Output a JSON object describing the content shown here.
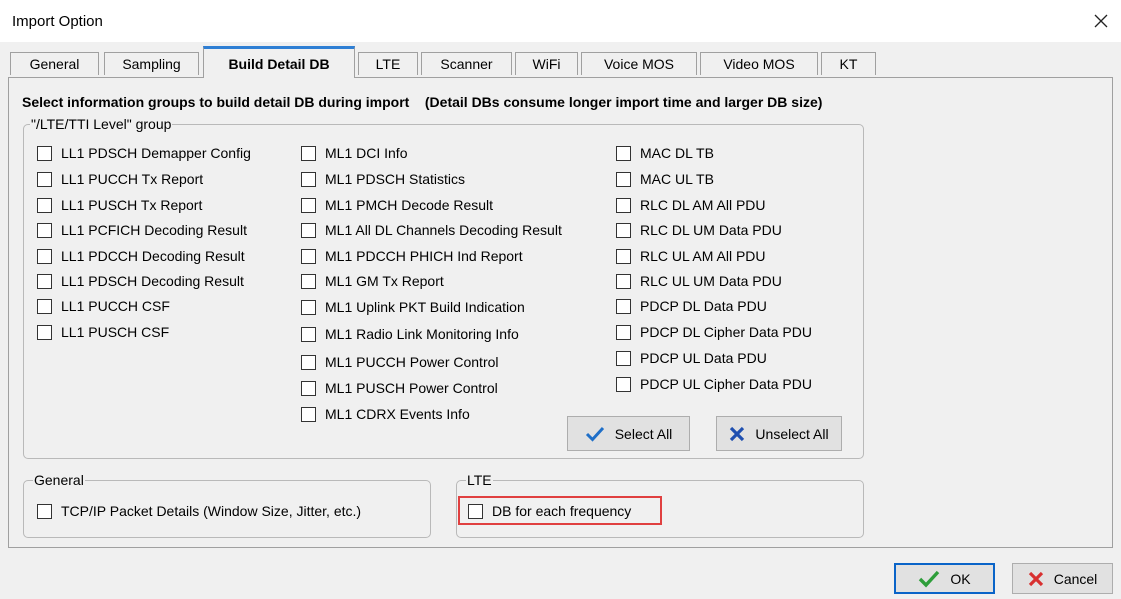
{
  "window": {
    "title": "Import Option"
  },
  "tabs": [
    {
      "label": "General"
    },
    {
      "label": "Sampling"
    },
    {
      "label": "Build Detail DB"
    },
    {
      "label": "LTE"
    },
    {
      "label": "Scanner"
    },
    {
      "label": "WiFi"
    },
    {
      "label": "Voice MOS"
    },
    {
      "label": "Video MOS"
    },
    {
      "label": "KT"
    }
  ],
  "active_tab": "Build Detail DB",
  "heading": "Select information groups to build detail DB during import    (Detail DBs consume longer import time and larger DB size)",
  "lte_group": {
    "legend": "\"/LTE/TTI Level\" group",
    "col1": [
      "LL1 PDSCH Demapper Config",
      "LL1 PUCCH Tx Report",
      "LL1 PUSCH Tx Report",
      "LL1 PCFICH Decoding Result",
      "LL1 PDCCH Decoding Result",
      "LL1 PDSCH Decoding Result",
      "LL1 PUCCH CSF",
      "LL1 PUSCH CSF"
    ],
    "col2": [
      "ML1 DCI Info",
      "ML1 PDSCH Statistics",
      "ML1 PMCH Decode Result",
      "ML1 All DL Channels Decoding Result",
      "ML1 PDCCH PHICH Ind Report",
      "ML1 GM Tx Report",
      "ML1 Uplink PKT Build Indication",
      "ML1 Radio Link Monitoring Info",
      "ML1 PUCCH Power Control",
      "ML1 PUSCH Power Control",
      "ML1 CDRX Events Info"
    ],
    "col3": [
      "MAC DL TB",
      "MAC UL TB",
      "RLC DL AM All PDU",
      "RLC DL UM Data PDU",
      "RLC UL AM All PDU",
      "RLC UL UM Data PDU",
      "PDCP DL Data PDU",
      "PDCP DL Cipher Data PDU",
      "PDCP UL Data PDU",
      "PDCP UL Cipher Data PDU"
    ],
    "select_all_label": "Select All",
    "unselect_all_label": "Unselect All"
  },
  "general_group": {
    "legend": "General",
    "item": "TCP/IP Packet Details (Window Size, Jitter, etc.)"
  },
  "lte_box": {
    "legend": "LTE",
    "item": "DB for each frequency"
  },
  "footer": {
    "ok_label": "OK",
    "cancel_label": "Cancel"
  },
  "colors": {
    "accent": "#2f7fd4",
    "check_green": "#2e9e3a",
    "cancel_red": "#d83030",
    "highlight": "#e04040"
  },
  "icons": {
    "close": "close-icon",
    "check": "check-icon",
    "x": "x-icon"
  }
}
